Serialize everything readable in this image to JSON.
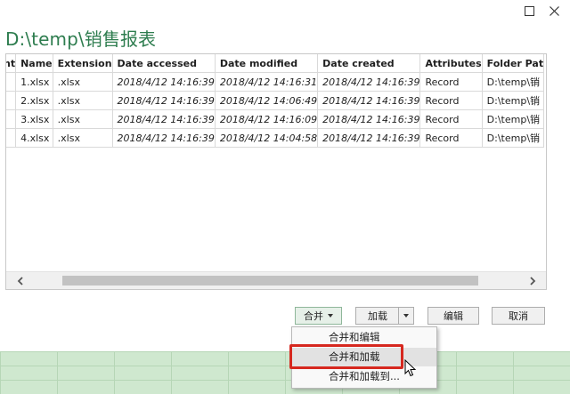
{
  "title": "D:\\temp\\销售报表",
  "table": {
    "columns": [
      "nt",
      "Name",
      "Extension",
      "Date accessed",
      "Date modified",
      "Date created",
      "Attributes",
      "Folder Pat"
    ],
    "rows": [
      [
        "",
        "1.xlsx",
        ".xlsx",
        "2018/4/12 14:16:39",
        "2018/4/12 14:16:31",
        "2018/4/12 14:16:39",
        "Record",
        "D:\\temp\\销"
      ],
      [
        "",
        "2.xlsx",
        ".xlsx",
        "2018/4/12 14:16:39",
        "2018/4/12 14:06:49",
        "2018/4/12 14:16:39",
        "Record",
        "D:\\temp\\销"
      ],
      [
        "",
        "3.xlsx",
        ".xlsx",
        "2018/4/12 14:16:39",
        "2018/4/12 14:16:09",
        "2018/4/12 14:16:39",
        "Record",
        "D:\\temp\\销"
      ],
      [
        "",
        "4.xlsx",
        ".xlsx",
        "2018/4/12 14:16:39",
        "2018/4/12 14:04:58",
        "2018/4/12 14:16:39",
        "Record",
        "D:\\temp\\销"
      ]
    ]
  },
  "buttons": {
    "merge": "合并",
    "load": "加载",
    "edit": "编辑",
    "cancel": "取消"
  },
  "menu": {
    "items": [
      "合并和编辑",
      "合并和加载",
      "合并和加载到..."
    ]
  },
  "icons": {
    "maximize": "maximize-icon",
    "close": "close-icon",
    "scroll_left": "chevron-left-icon",
    "scroll_right": "chevron-right-icon",
    "merge_caret": "caret-down-icon",
    "load_caret": "caret-down-icon",
    "cursor": "mouse-pointer-icon"
  },
  "colors": {
    "title": "#2e7d4f",
    "highlight": "#d6281f",
    "sheet": "#cfe8cf"
  }
}
